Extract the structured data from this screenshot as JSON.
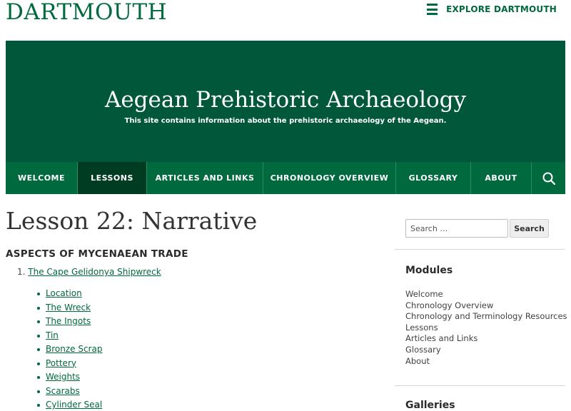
{
  "header": {
    "logo": "DARTMOUTH",
    "explore_label": "EXPLORE DARTMOUTH"
  },
  "hero": {
    "title": "Aegean Prehistoric Archaeology",
    "description": "This site contains information about the prehistoric archaeology of the Aegean."
  },
  "nav": {
    "items": [
      {
        "label": "WELCOME"
      },
      {
        "label": "LESSONS",
        "active": true
      },
      {
        "label": "ARTICLES AND LINKS"
      },
      {
        "label": "CHRONOLOGY OVERVIEW"
      },
      {
        "label": "GLOSSARY"
      },
      {
        "label": "ABOUT"
      }
    ],
    "search_icon": "search-icon"
  },
  "main": {
    "title": "Lesson 22: Narrative",
    "section_heading": "ASPECTS OF MYCENAEAN TRADE",
    "ordered_item": {
      "number": "1.",
      "label": "The Cape Gelidonya Shipwreck"
    },
    "subitems": [
      "Location",
      "The Wreck",
      "The Ingots",
      "Tin",
      "Bronze Scrap",
      "Pottery",
      "Weights",
      "Scarabs",
      "Cylinder Seal"
    ]
  },
  "sidebar": {
    "search": {
      "placeholder": "Search …",
      "button_label": "Search"
    },
    "modules": {
      "title": "Modules",
      "items": [
        "Welcome",
        "Chronology Overview",
        "Chronology and Terminology Resources",
        "Lessons",
        "Articles and Links",
        "Glossary",
        "About"
      ]
    },
    "galleries": {
      "title": "Galleries"
    }
  },
  "colors": {
    "brand_green": "#00693e",
    "hero_green": "#00573a",
    "nav_active": "#003c21"
  }
}
